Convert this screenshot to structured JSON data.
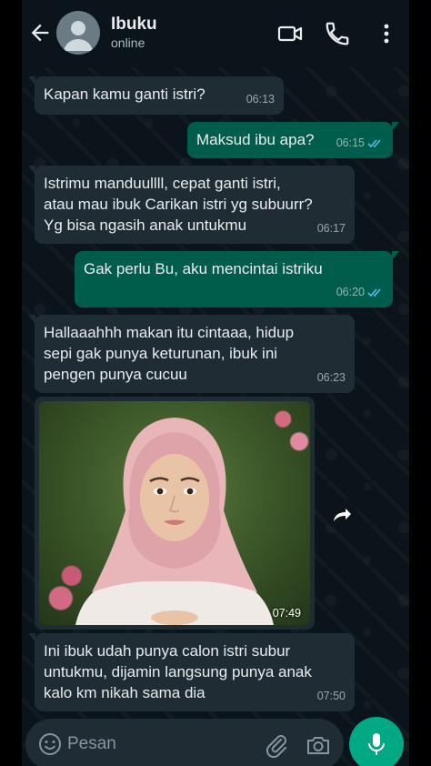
{
  "header": {
    "contact_name": "Ibuku",
    "status": "online",
    "icons": [
      "back-arrow-icon",
      "video-call-icon",
      "voice-call-icon",
      "more-options-icon"
    ]
  },
  "messages": [
    {
      "direction": "incoming",
      "text": "Kapan kamu ganti istri?",
      "time": "06:13"
    },
    {
      "direction": "outgoing",
      "text": "Maksud ibu apa?",
      "time": "06:15",
      "status": "read"
    },
    {
      "direction": "incoming",
      "text": "Istrimu manduullll, cepat ganti istri,\natau mau ibuk Carikan istri yg subuurr?\nYg bisa ngasih anak untukmu",
      "time": "06:17"
    },
    {
      "direction": "outgoing",
      "text": "Gak perlu Bu, aku mencintai istriku",
      "time": "06:20",
      "status": "read"
    },
    {
      "direction": "incoming",
      "text": "Hallaaahhh makan itu cintaaa, hidup\nsepi gak punya keturunan, ibuk ini\npengen punya cucuu",
      "time": "06:23"
    },
    {
      "direction": "incoming",
      "type": "image",
      "image": "photo of young woman in pink hijab in garden",
      "time": "07:49"
    },
    {
      "direction": "incoming",
      "text": "Ini ibuk udah punya calon istri subur\nuntukmu, dijamin langsung punya anak\nkalo km nikah sama dia",
      "time": "07:50"
    }
  ],
  "composer": {
    "placeholder": "Pesan",
    "icons": [
      "emoji-icon",
      "attach-icon",
      "camera-icon",
      "microphone-icon"
    ]
  },
  "colors": {
    "background": "#0b141a",
    "incoming_bubble": "#202c33",
    "outgoing_bubble": "#005c4b",
    "read_tick": "#53bdeb",
    "accent": "#00a884"
  }
}
